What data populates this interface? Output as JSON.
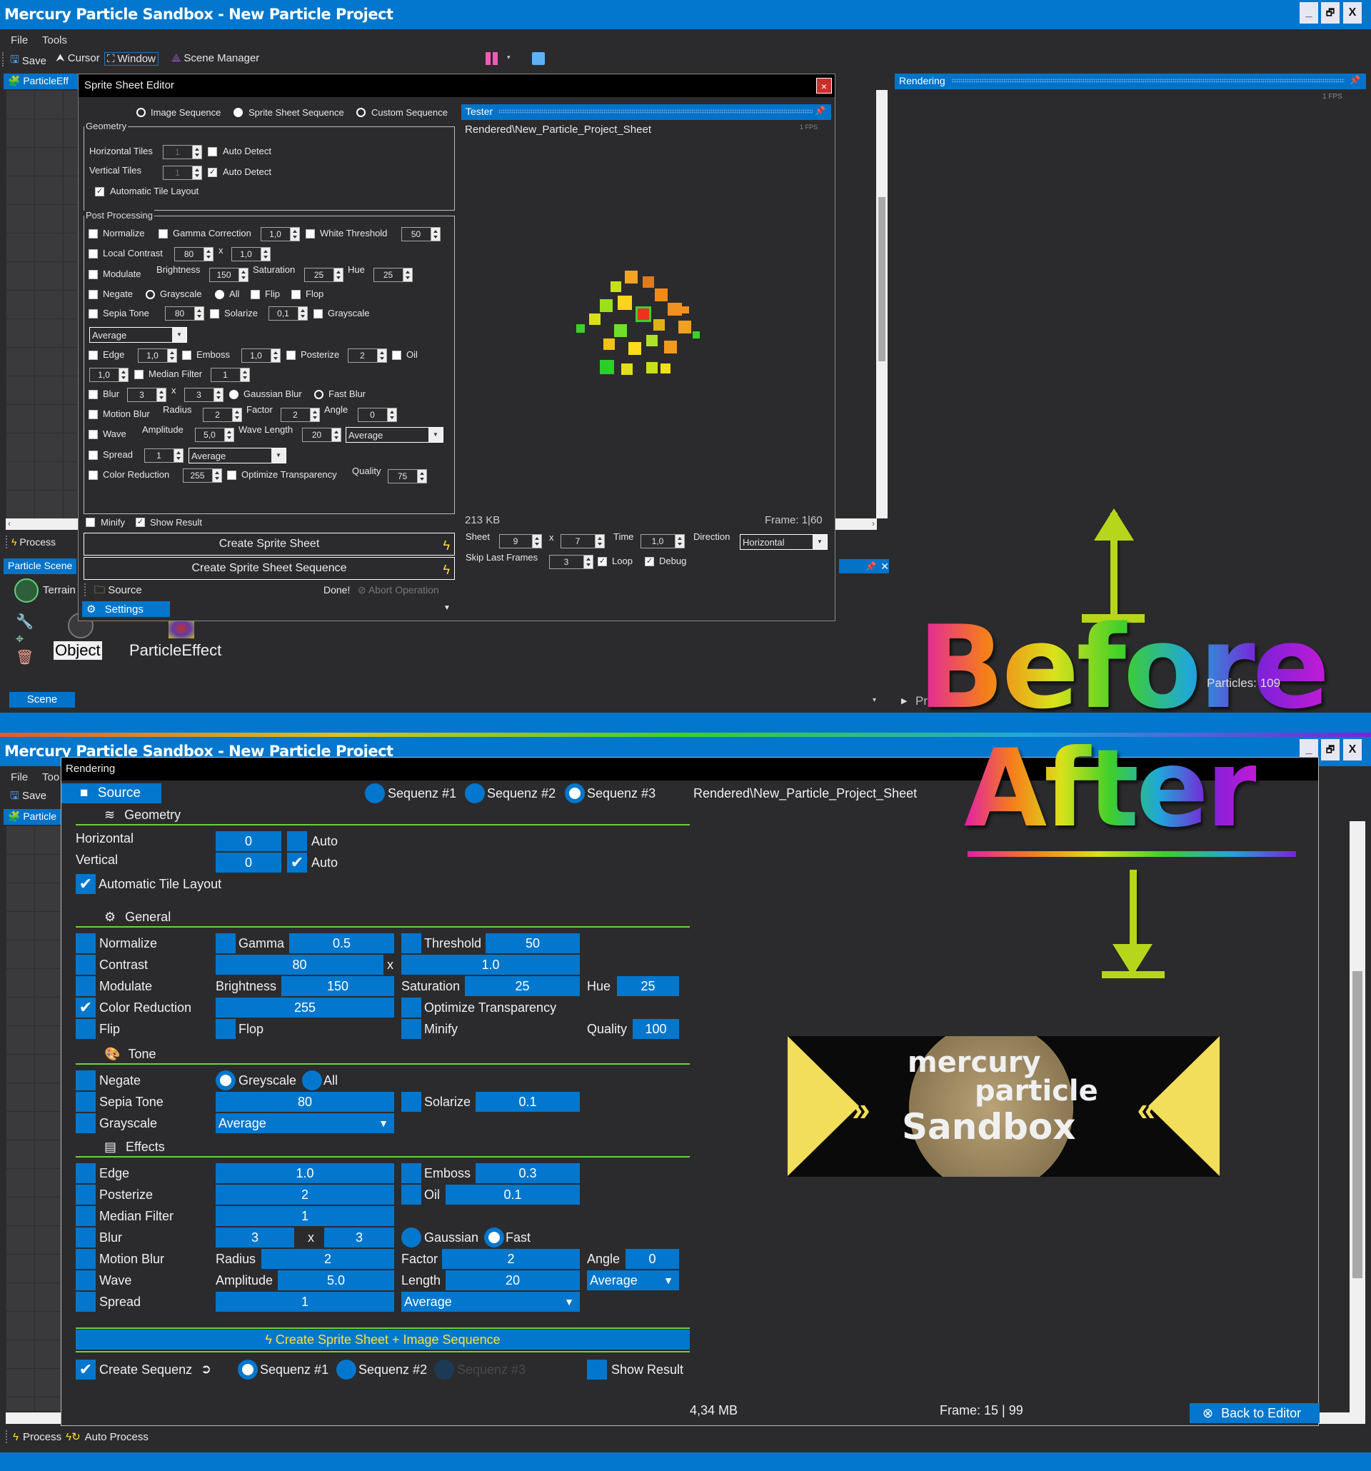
{
  "app": {
    "title": "Mercury Particle Sandbox - New Particle Project",
    "window_controls": {
      "minimize": "_",
      "restore": "🗗",
      "close": "X"
    },
    "menu": [
      "File",
      "Tools"
    ],
    "toolbar": {
      "save": "Save",
      "cursor": "Cursor",
      "window": "Window",
      "scene_manager": "Scene Manager"
    },
    "colors": {
      "accent": "#0277cd",
      "background": "#2b2b2d",
      "section_line": "#6ed13a",
      "bolt": "#ffe033"
    }
  },
  "before": {
    "label": "Before",
    "left_panel": {
      "tab": "ParticleEff",
      "process": "Process",
      "scene_tab": "Particle Scene",
      "terrain": "Terrain",
      "object": "Object",
      "particle_effect": "ParticleEffect",
      "scene_button": "Scene"
    },
    "rendering_panel": {
      "title": "Rendering",
      "fps": "1 FPS",
      "particles_label": "Particles:",
      "particles_value": "109",
      "properties": "Properties"
    },
    "dialog": {
      "title": "Sprite Sheet Editor",
      "close": "×",
      "modes": [
        {
          "label": "Image Sequence",
          "selected": false
        },
        {
          "label": "Sprite Sheet Sequence",
          "selected": true
        },
        {
          "label": "Custom Sequence",
          "selected": false
        }
      ],
      "geometry": {
        "legend": "Geometry",
        "horizontal_label": "Horizontal Tiles",
        "horizontal_value": "1",
        "horizontal_auto": "Auto Detect",
        "horizontal_auto_checked": false,
        "vertical_label": "Vertical Tiles",
        "vertical_value": "1",
        "vertical_auto": "Auto Detect",
        "vertical_auto_checked": true,
        "auto_layout": "Automatic Tile Layout",
        "auto_layout_checked": true
      },
      "post": {
        "legend": "Post Processing",
        "normalize": "Normalize",
        "gamma": "Gamma Correction",
        "gamma_value": "1,0",
        "white_threshold": "White Threshold",
        "white_threshold_value": "50",
        "local_contrast": "Local Contrast",
        "local_contrast_a": "80",
        "x": "x",
        "local_contrast_b": "1,0",
        "modulate": "Modulate",
        "brightness": "Brightness",
        "brightness_value": "150",
        "saturation": "Saturation",
        "saturation_value": "25",
        "hue": "Hue",
        "hue_value": "25",
        "negate": "Negate",
        "grayscale_radio": "Grayscale",
        "all_radio": "All",
        "flip": "Flip",
        "flop": "Flop",
        "sepia": "Sepia Tone",
        "sepia_value": "80",
        "solarize": "Solarize",
        "solarize_value": "0,1",
        "grayscale": "Grayscale",
        "grayscale_method": "Average",
        "edge": "Edge",
        "edge_value": "1,0",
        "emboss": "Emboss",
        "emboss_value": "1,0",
        "posterize": "Posterize",
        "posterize_value": "2",
        "oil": "Oil",
        "oil_value": "1,0",
        "median": "Median Filter",
        "median_value": "1",
        "blur": "Blur",
        "blur_a": "3",
        "blur_b": "3",
        "gaussian": "Gaussian Blur",
        "fast": "Fast Blur",
        "motion_blur": "Motion Blur",
        "radius": "Radius",
        "radius_value": "2",
        "factor": "Factor",
        "factor_value": "2",
        "angle": "Angle",
        "angle_value": "0",
        "wave": "Wave",
        "amplitude": "Amplitude",
        "amplitude_value": "5,0",
        "wave_length": "Wave Length",
        "wave_length_value": "20",
        "wave_method": "Average",
        "spread": "Spread",
        "spread_value": "1",
        "spread_method": "Average",
        "color_reduction": "Color Reduction",
        "color_reduction_value": "255",
        "optimize": "Optimize Transparency",
        "quality": "Quality",
        "quality_value": "75"
      },
      "minify": "Minify",
      "show_result": "Show Result",
      "show_result_checked": true,
      "create_sprite_sheet": "Create Sprite Sheet",
      "create_sprite_sheet_sequence": "Create Sprite Sheet Sequence",
      "source": "Source",
      "status": "Done!",
      "abort": "Abort Operation",
      "settings": "Settings",
      "tester": {
        "title": "Tester",
        "path": "Rendered\\New_Particle_Project_Sheet",
        "fps": "1 FPS",
        "size": "213 KB",
        "frame_label": "Frame:",
        "frame_current": "1",
        "frame_total": "60",
        "sheet": "Sheet",
        "sheet_a": "9",
        "sheet_b": "7",
        "time": "Time",
        "time_value": "1,0",
        "direction": "Direction",
        "direction_value": "Horizontal",
        "skip_last": "Skip Last Frames",
        "skip_value": "3",
        "loop": "Loop",
        "debug": "Debug"
      }
    }
  },
  "after": {
    "label": "After",
    "dialog": {
      "title": "Rendering",
      "source": "Source",
      "sequences": [
        {
          "label": "Sequenz #1",
          "selected": false
        },
        {
          "label": "Sequenz #2",
          "selected": false
        },
        {
          "label": "Sequenz #3",
          "selected": true
        }
      ],
      "path": "Rendered\\New_Particle_Project_Sheet",
      "geometry": {
        "title": "Geometry",
        "horizontal": "Horizontal",
        "horizontal_value": "0",
        "auto": "Auto",
        "horizontal_auto": false,
        "vertical": "Vertical",
        "vertical_value": "0",
        "vertical_auto": true,
        "auto_layout": "Automatic  Tile  Layout",
        "auto_layout_checked": true
      },
      "general": {
        "title": "General",
        "normalize": "Normalize",
        "gamma": "Gamma",
        "gamma_value": "0.5",
        "threshold": "Threshold",
        "threshold_value": "50",
        "contrast": "Contrast",
        "contrast_a": "80",
        "x": "x",
        "contrast_b": "1.0",
        "modulate": "Modulate",
        "brightness": "Brightness",
        "brightness_value": "150",
        "saturation": "Saturation",
        "saturation_value": "25",
        "hue": "Hue",
        "hue_value": "25",
        "color_reduction": "Color  Reduction",
        "color_reduction_checked": true,
        "color_reduction_value": "255",
        "optimize": "Optimize  Transparency",
        "flip": "Flip",
        "flop": "Flop",
        "minify": "Minify",
        "quality": "Quality",
        "quality_value": "100"
      },
      "tone": {
        "title": "Tone",
        "negate": "Negate",
        "greyscale": "Greyscale",
        "greyscale_selected": true,
        "all": "All",
        "sepia": "Sepia  Tone",
        "sepia_value": "80",
        "solarize": "Solarize",
        "solarize_value": "0.1",
        "grayscale": "Grayscale",
        "grayscale_method": "Average"
      },
      "effects": {
        "title": "Effects",
        "edge": "Edge",
        "edge_value": "1.0",
        "emboss": "Emboss",
        "emboss_value": "0.3",
        "posterize": "Posterize",
        "posterize_value": "2",
        "oil": "Oil",
        "oil_value": "0.1",
        "median": "Median  Filter",
        "median_value": "1",
        "blur": "Blur",
        "blur_a": "3",
        "x": "x",
        "blur_b": "3",
        "gaussian": "Gaussian",
        "fast": "Fast",
        "fast_selected": true,
        "motion_blur": "Motion  Blur",
        "radius": "Radius",
        "radius_value": "2",
        "factor": "Factor",
        "factor_value": "2",
        "angle": "Angle",
        "angle_value": "0",
        "wave": "Wave",
        "amplitude": "Amplitude",
        "amplitude_value": "5.0",
        "length": "Length",
        "length_value": "20",
        "wave_method": "Average",
        "spread": "Spread",
        "spread_value": "1",
        "spread_method": "Average"
      },
      "create_button": "Create  Sprite  Sheet  +  Image  Sequence",
      "create_sequence": "Create  Sequenz",
      "create_sequence_checked": true,
      "bottom_sequences": [
        {
          "label": "Sequenz  #1",
          "selected": true,
          "enabled": true
        },
        {
          "label": "Sequenz  #2",
          "selected": false,
          "enabled": true
        },
        {
          "label": "Sequenz  #3",
          "selected": false,
          "enabled": false
        }
      ],
      "show_result": "Show  Result",
      "size": "4,34  MB",
      "frame": "Frame:  15  |  99",
      "back_to_editor": "Back  to  Editor"
    },
    "logo": {
      "line1": "mercury",
      "line2": "particle",
      "line3": "Sandbox"
    },
    "bottom_bar": {
      "process": "Process",
      "auto_process": "Auto Process"
    },
    "background": {
      "menu_partial": [
        "File",
        "Too"
      ],
      "save": "Save",
      "tab": "Particle"
    }
  }
}
